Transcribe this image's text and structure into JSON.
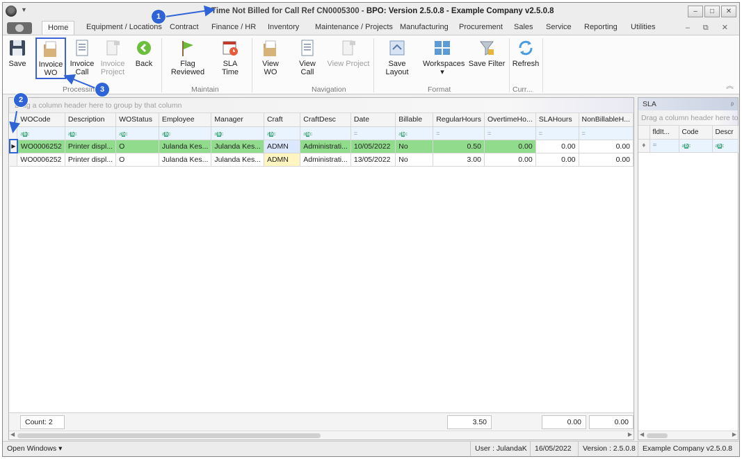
{
  "window": {
    "title_prefix": "Time Not Billed for Call Ref CN0005300 - ",
    "title_bold": "BPO: Version 2.5.0.8 - Example Company v2.5.0.8",
    "controls": {
      "minimize": "–",
      "maximize": "□",
      "close": "✕"
    }
  },
  "menu": {
    "tabs": [
      "Home",
      "Equipment / Locations",
      "Contract",
      "Finance / HR",
      "Inventory",
      "Maintenance / Projects",
      "Manufacturing",
      "Procurement",
      "Sales",
      "Service",
      "Reporting",
      "Utilities"
    ],
    "active_tab": "Home",
    "right_icons": "– ⧉ ✕"
  },
  "ribbon": {
    "buttons": {
      "save": "Save",
      "invoice_wo": [
        "Invoice",
        "WO"
      ],
      "invoice_call": [
        "Invoice",
        "Call"
      ],
      "invoice_project": [
        "Invoice",
        "Project"
      ],
      "back": "Back",
      "flag_reviewed": "Flag Reviewed",
      "sla_time": "SLA Time",
      "view_wo": "View WO",
      "view_call": "View Call",
      "view_project": "View Project",
      "save_layout": "Save Layout",
      "workspaces": "Workspaces",
      "save_filter": "Save Filter",
      "refresh": "Refresh"
    },
    "groups": {
      "processing": "Processing",
      "maintain": "Maintain",
      "navigation": "Navigation",
      "format": "Format",
      "currency": "Curr..."
    }
  },
  "grid": {
    "group_hint": "Drag a column header here to group by that column",
    "columns": [
      "WOCode",
      "Description",
      "WOStatus",
      "Employee",
      "Manager",
      "Craft",
      "CraftDesc",
      "Date",
      "Billable",
      "RegularHours",
      "OvertimeHo...",
      "SLAHours",
      "NonBillableH..."
    ],
    "rows": [
      [
        "WO0006252",
        "Printer displ...",
        "O",
        "Julanda Kes...",
        "Julanda Kes...",
        "ADMN",
        "Administrati...",
        "10/05/2022",
        "No",
        "0.50",
        "0.00",
        "0.00",
        "0.00"
      ],
      [
        "WO0006252",
        "Printer displ...",
        "O",
        "Julanda Kes...",
        "Julanda Kes...",
        "ADMN",
        "Administrati...",
        "13/05/2022",
        "No",
        "3.00",
        "0.00",
        "0.00",
        "0.00"
      ]
    ],
    "footer": {
      "count": "Count: 2",
      "regular_hours_total": "3.50",
      "sla_hours_total": "0.00",
      "non_billable_total": "0.00"
    }
  },
  "sla_panel": {
    "title": "SLA",
    "pin": "ᵖ",
    "group_hint": "Drag a column header here to g",
    "columns": [
      "fldIt...",
      "Code",
      "Descr"
    ]
  },
  "statusbar": {
    "open_windows": "Open Windows ▾",
    "user": "User : JulandaK",
    "date": "16/05/2022",
    "version": "Version : 2.5.0.8",
    "company": "Example Company v2.5.0.8"
  },
  "annotations": {
    "markers": [
      "1",
      "2",
      "3"
    ],
    "color": "#2f63d8"
  }
}
